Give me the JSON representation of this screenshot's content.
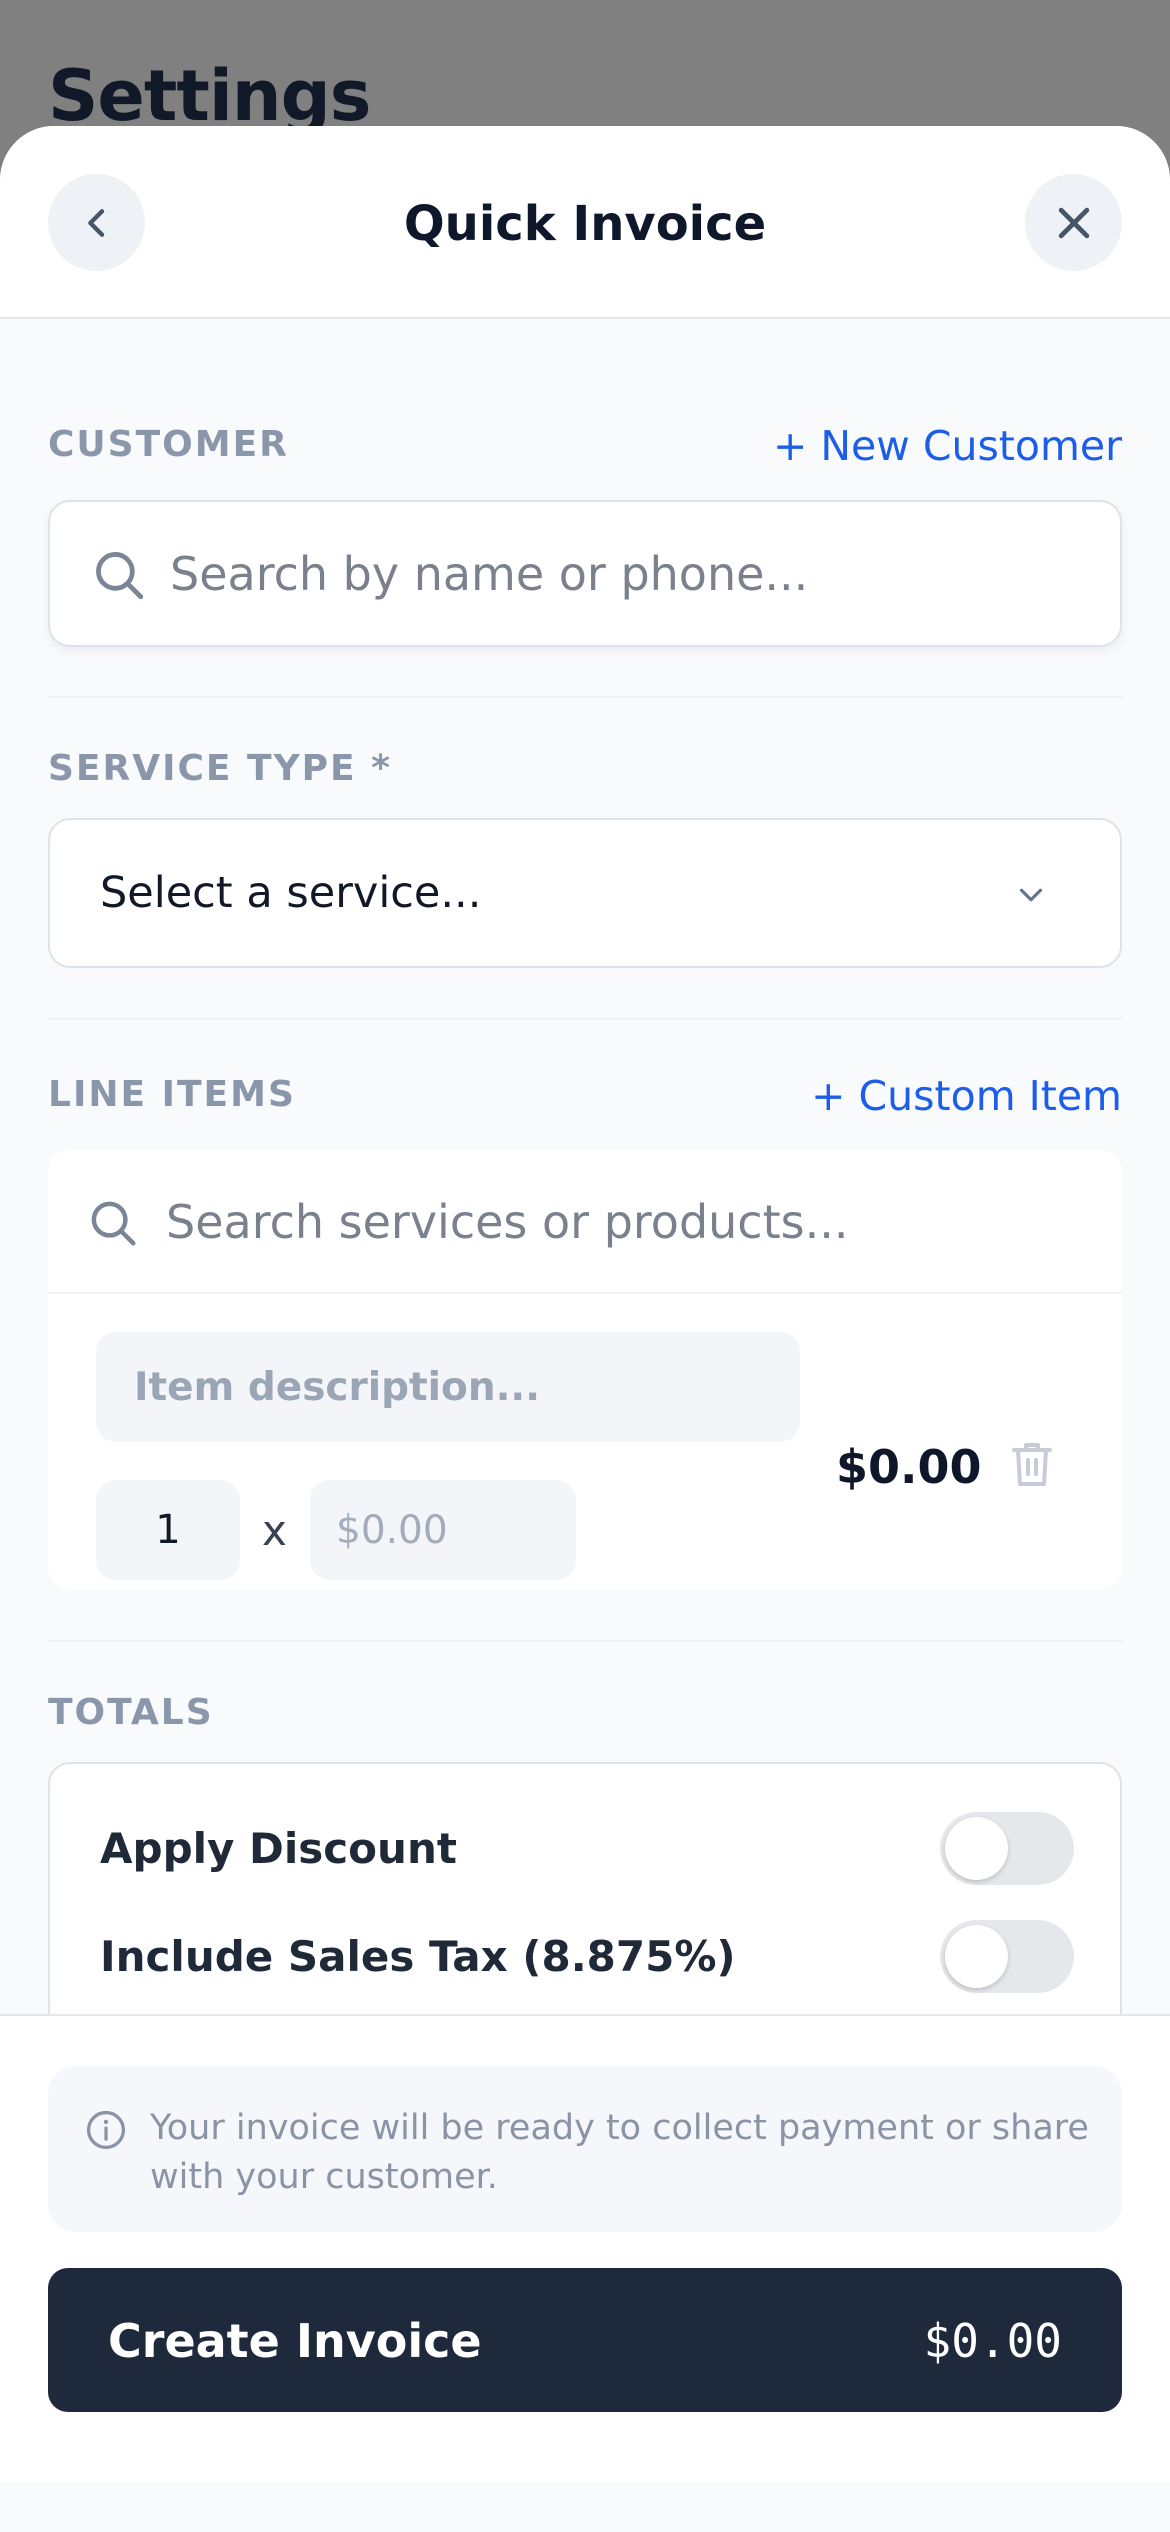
{
  "backdrop": {
    "title": "Settings"
  },
  "header": {
    "title": "Quick Invoice"
  },
  "customer": {
    "label": "CUSTOMER",
    "new_link": "+ New Customer",
    "search_placeholder": "Search by name or phone..."
  },
  "service": {
    "label": "SERVICE TYPE *",
    "selected": "Select a service..."
  },
  "line_items": {
    "label": "LINE ITEMS",
    "custom_link": "+ Custom Item",
    "search_placeholder": "Search services or products...",
    "items": [
      {
        "description_placeholder": "Item description...",
        "quantity": "1",
        "times": "x",
        "price_placeholder": "$0.00",
        "total": "$0.00"
      }
    ]
  },
  "totals": {
    "label": "TOTALS",
    "apply_discount": "Apply Discount",
    "apply_discount_on": false,
    "sales_tax": "Include Sales Tax (8.875%)",
    "sales_tax_on": false
  },
  "footer": {
    "info": "Your invoice will be ready to collect payment or share with your customer.",
    "create_label": "Create Invoice",
    "create_amount": "$0.00"
  },
  "colors": {
    "accent": "#1d5ee8",
    "primary_button": "#1e293b"
  }
}
